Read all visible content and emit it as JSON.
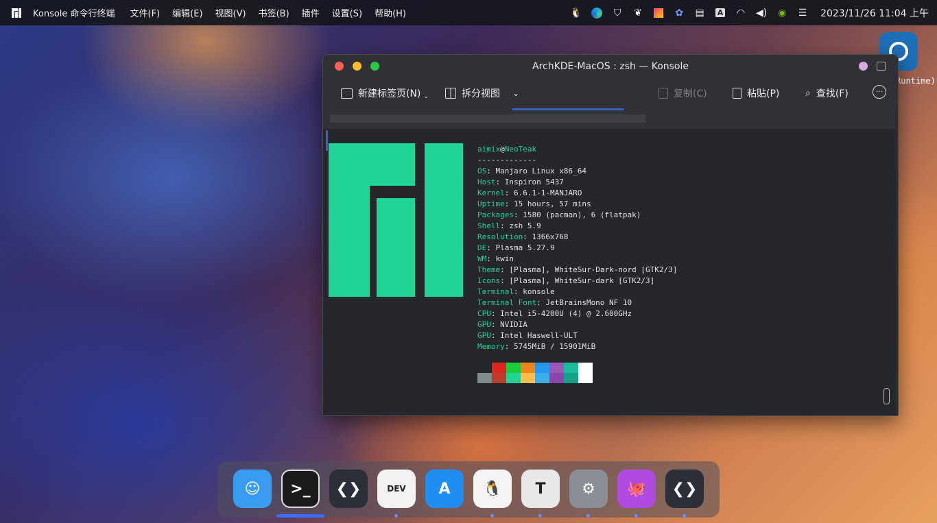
{
  "topbar": {
    "app_name": "Konsole 命令行终端",
    "menus": [
      "文件(F)",
      "编辑(E)",
      "视图(V)",
      "书签(B)",
      "插件",
      "设置(S)",
      "帮助(H)"
    ],
    "clock": "2023/11/26 11:04 上午",
    "tray_icons": [
      "qq-icon",
      "edge-icon",
      "shield-icon",
      "flame-icon",
      "cube-icon",
      "gear-tray-icon",
      "clipboard-icon",
      "keyboard-icon",
      "wifi-icon",
      "volume-icon",
      "nvidia-icon",
      "toggle-icon"
    ]
  },
  "desktop": {
    "corner_label": "Runtime)"
  },
  "window": {
    "title": "ArchKDE-MacOS : zsh — Konsole",
    "toolbar": {
      "new_tab": "新建标签页(N)",
      "split_view": "拆分视图",
      "copy": "复制(C)",
      "paste": "粘贴(P)",
      "find": "查找(F)"
    }
  },
  "terminal": {
    "user": "aimix",
    "at": "@",
    "host": "NeoTeak",
    "separator": "-------------",
    "rows": [
      {
        "key": "OS",
        "value": ": Manjaro Linux x86_64"
      },
      {
        "key": "Host",
        "value": ": Inspiron 5437"
      },
      {
        "key": "Kernel",
        "value": ": 6.6.1-1-MANJARO"
      },
      {
        "key": "Uptime",
        "value": ": 15 hours, 57 mins"
      },
      {
        "key": "Packages",
        "value": ": 1580 (pacman), 6 (flatpak)"
      },
      {
        "key": "Shell",
        "value": ": zsh 5.9"
      },
      {
        "key": "Resolution",
        "value": ": 1366x768"
      },
      {
        "key": "DE",
        "value": ": Plasma 5.27.9"
      },
      {
        "key": "WM",
        "value": ": kwin"
      },
      {
        "key": "Theme",
        "value": ": [Plasma], WhiteSur-Dark-nord [GTK2/3]"
      },
      {
        "key": "Icons",
        "value": ": [Plasma], WhiteSur-dark [GTK2/3]"
      },
      {
        "key": "Terminal",
        "value": ": konsole"
      },
      {
        "key": "Terminal Font",
        "value": ": JetBrainsMono NF 10"
      },
      {
        "key": "CPU",
        "value": ": Intel i5-4200U (4) @ 2.600GHz"
      },
      {
        "key": "GPU",
        "value": ": NVIDIA"
      },
      {
        "key": "GPU",
        "value": ": Intel Haswell-ULT"
      },
      {
        "key": "Memory",
        "value": ": 5745MiB / 15901MiB"
      }
    ],
    "palette_top": [
      "#25272c",
      "#e02525",
      "#1ecb3a",
      "#ef8516",
      "#2597ef",
      "#9b59b6",
      "#1abc9c",
      "#ffffff"
    ],
    "palette_bottom": [
      "#7f8c8d",
      "#c0392b",
      "#1fd494",
      "#fdbc4b",
      "#3daee9",
      "#8e44ad",
      "#16a085",
      "#ffffff"
    ]
  },
  "dock": {
    "apps": [
      {
        "name": "finder-icon",
        "color": "#3a9cf0",
        "glyph": "☺"
      },
      {
        "name": "terminal-icon",
        "color": "#1a1a1a",
        "glyph": ">_"
      },
      {
        "name": "vscode-icon",
        "color": "#2b2f38",
        "glyph": "❮❯"
      },
      {
        "name": "edge-dev-icon",
        "color": "#f2f2f2",
        "glyph": "DEV"
      },
      {
        "name": "app-store-icon",
        "color": "#1f8ef0",
        "glyph": "A"
      },
      {
        "name": "qq-dock-icon",
        "color": "#f4f4f4",
        "glyph": "🐧"
      },
      {
        "name": "typora-icon",
        "color": "#e8e8e8",
        "glyph": "T"
      },
      {
        "name": "settings-icon",
        "color": "#8a8e96",
        "glyph": "⚙"
      },
      {
        "name": "github-icon",
        "color": "#b04ae0",
        "glyph": "🐙"
      },
      {
        "name": "vscode-icon-2",
        "color": "#2b2f38",
        "glyph": "❮❯"
      }
    ]
  }
}
